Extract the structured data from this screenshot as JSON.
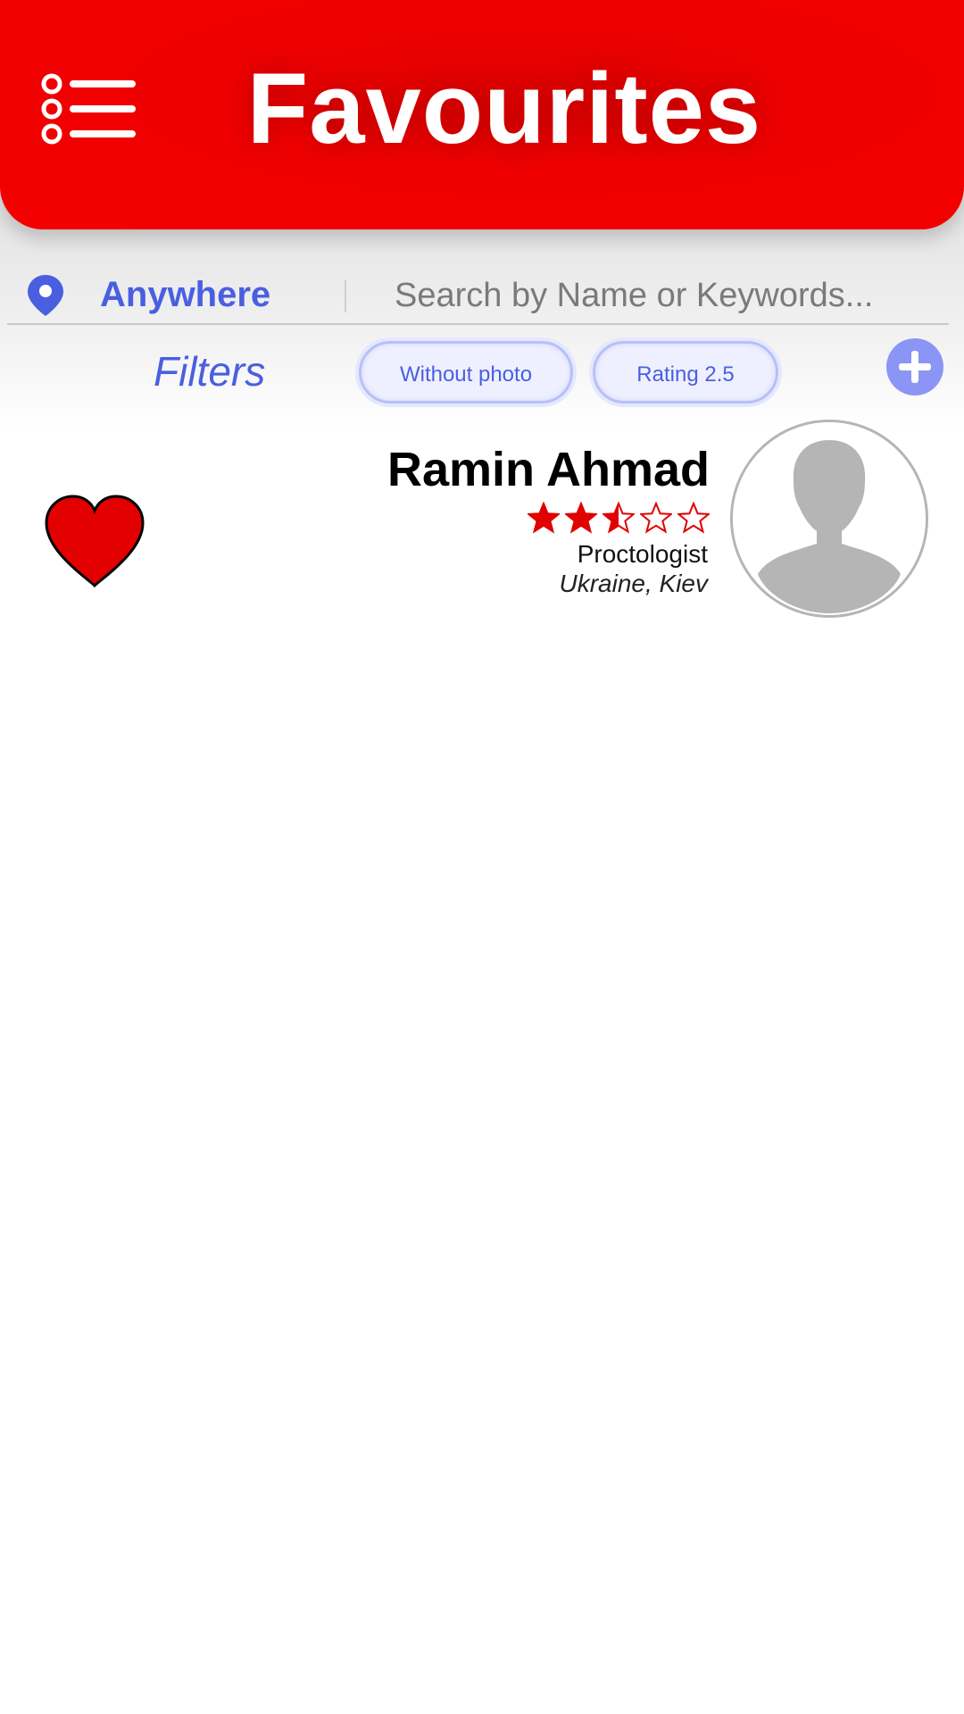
{
  "header": {
    "title": "Favourites",
    "menu_icon": "list-menu-icon"
  },
  "search": {
    "location_icon": "location-pin-icon",
    "location_label": "Anywhere",
    "placeholder": "Search by Name or Keywords..."
  },
  "filters": {
    "label": "Filters",
    "chips": [
      "Without photo",
      "Rating 2.5"
    ],
    "add_icon": "plus-icon"
  },
  "favourites": [
    {
      "name": "Ramin Ahmad",
      "rating": 2.5,
      "rating_max": 5,
      "specialty": "Proctologist",
      "location": "Ukraine, Kiev",
      "favourite_icon": "heart-icon",
      "avatar_icon": "avatar-placeholder-icon"
    }
  ],
  "colors": {
    "header_red": "#f00000",
    "accent_blue": "#4a5fe0",
    "chip_bg": "#eef0ff",
    "star_red": "#e00000",
    "add_button": "#8b95f5"
  }
}
